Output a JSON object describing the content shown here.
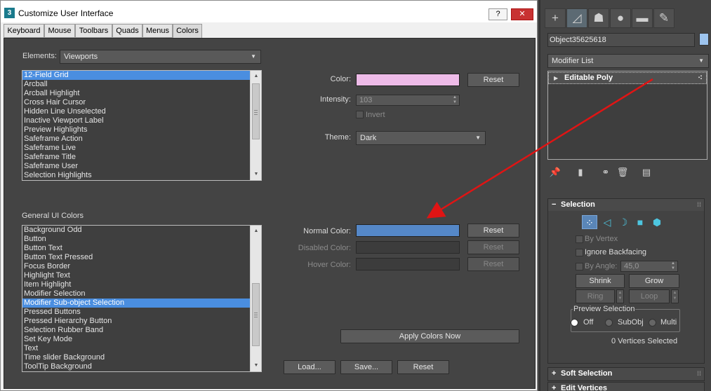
{
  "window": {
    "icon_text": "3",
    "title": "Customize User Interface",
    "help_label": "?",
    "close_label": "✕"
  },
  "tabs": [
    {
      "label": "Keyboard"
    },
    {
      "label": "Mouse"
    },
    {
      "label": "Toolbars"
    },
    {
      "label": "Quads"
    },
    {
      "label": "Menus"
    },
    {
      "label": "Colors",
      "active": true
    }
  ],
  "elements": {
    "label": "Elements:",
    "selected": "Viewports",
    "list": [
      "12-Field Grid",
      "Arcball",
      "Arcball Highlight",
      "Cross Hair Cursor",
      "Hidden Line Unselected",
      "Inactive Viewport Label",
      "Preview Highlights",
      "Safeframe Action",
      "Safeframe Live",
      "Safeframe Title",
      "Safeframe User",
      "Selection Highlights"
    ],
    "selected_index": 0
  },
  "color_panel": {
    "color_label": "Color:",
    "color_value": "#eebbe8",
    "reset_label": "Reset",
    "intensity_label": "Intensity:",
    "intensity_value": "103",
    "invert_label": "Invert",
    "theme_label": "Theme:",
    "theme_value": "Dark"
  },
  "general": {
    "label": "General UI Colors",
    "list": [
      "Background Odd",
      "Button",
      "Button Text",
      "Button Text Pressed",
      "Focus Border",
      "Highlight Text",
      "Item Highlight",
      "Modifier Selection",
      "Modifier Sub-object Selection",
      "Pressed Buttons",
      "Pressed Hierarchy Button",
      "Selection Rubber Band",
      "Set Key Mode",
      "Text",
      "Time slider Background",
      "ToolTip Background"
    ],
    "selected_index": 8,
    "normal_label": "Normal Color:",
    "normal_value": "#5588c8",
    "disabled_label": "Disabled Color:",
    "hover_label": "Hover Color:",
    "reset_label": "Reset"
  },
  "footer": {
    "apply_label": "Apply Colors Now",
    "load_label": "Load...",
    "save_label": "Save...",
    "reset_label": "Reset"
  },
  "command_panel": {
    "object_name": "Object35625618",
    "object_color": "#9dc4ee",
    "modifier_list": "Modifier List",
    "stack_item": "Editable Poly",
    "selection": {
      "title": "Selection",
      "by_vertex": "By Vertex",
      "ignore_backfacing": "Ignore Backfacing",
      "by_angle": "By Angle:",
      "angle_value": "45,0",
      "shrink": "Shrink",
      "grow": "Grow",
      "ring": "Ring",
      "loop": "Loop",
      "preview_title": "Preview Selection",
      "off": "Off",
      "subobj": "SubObj",
      "multi": "Multi",
      "status": "0 Vertices Selected"
    },
    "soft_selection": "Soft Selection",
    "edit_vertices": "Edit Vertices"
  },
  "annotation": {
    "arrow_color": "#e01414"
  }
}
